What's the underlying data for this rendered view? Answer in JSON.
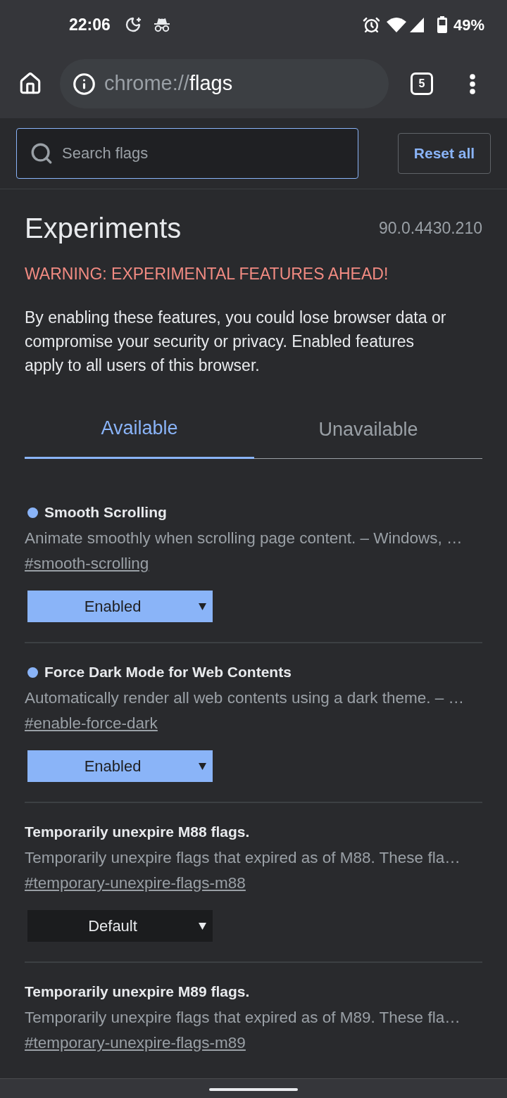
{
  "status_bar": {
    "time": "22:06",
    "battery": "49%"
  },
  "toolbar": {
    "url_scheme": "chrome://",
    "url_host": "flags",
    "tab_count": "5"
  },
  "search": {
    "placeholder": "Search flags"
  },
  "reset_button": {
    "label": "Reset all"
  },
  "header": {
    "title": "Experiments",
    "version": "90.0.4430.210",
    "warning": "WARNING: EXPERIMENTAL FEATURES AHEAD!",
    "description": "By enabling these features, you could lose browser data or compromise your security or privacy. Enabled features apply to all users of this browser."
  },
  "tabs": [
    {
      "label": "Available",
      "selected": true
    },
    {
      "label": "Unavailable",
      "selected": false
    }
  ],
  "flags": [
    {
      "title": "Smooth Scrolling",
      "modified": true,
      "description": "Animate smoothly when scrolling page content. – Windows, …",
      "link": "#smooth-scrolling",
      "value": "Enabled"
    },
    {
      "title": "Force Dark Mode for Web Contents",
      "modified": true,
      "description": "Automatically render all web contents using a dark theme. – …",
      "link": "#enable-force-dark",
      "value": "Enabled"
    },
    {
      "title": "Temporarily unexpire M88 flags.",
      "modified": false,
      "description": "Temporarily unexpire flags that expired as of M88. These fla…",
      "link": "#temporary-unexpire-flags-m88",
      "value": "Default"
    },
    {
      "title": "Temporarily unexpire M89 flags.",
      "modified": false,
      "description": "Temporarily unexpire flags that expired as of M89. These fla…",
      "link": "#temporary-unexpire-flags-m89"
    }
  ]
}
